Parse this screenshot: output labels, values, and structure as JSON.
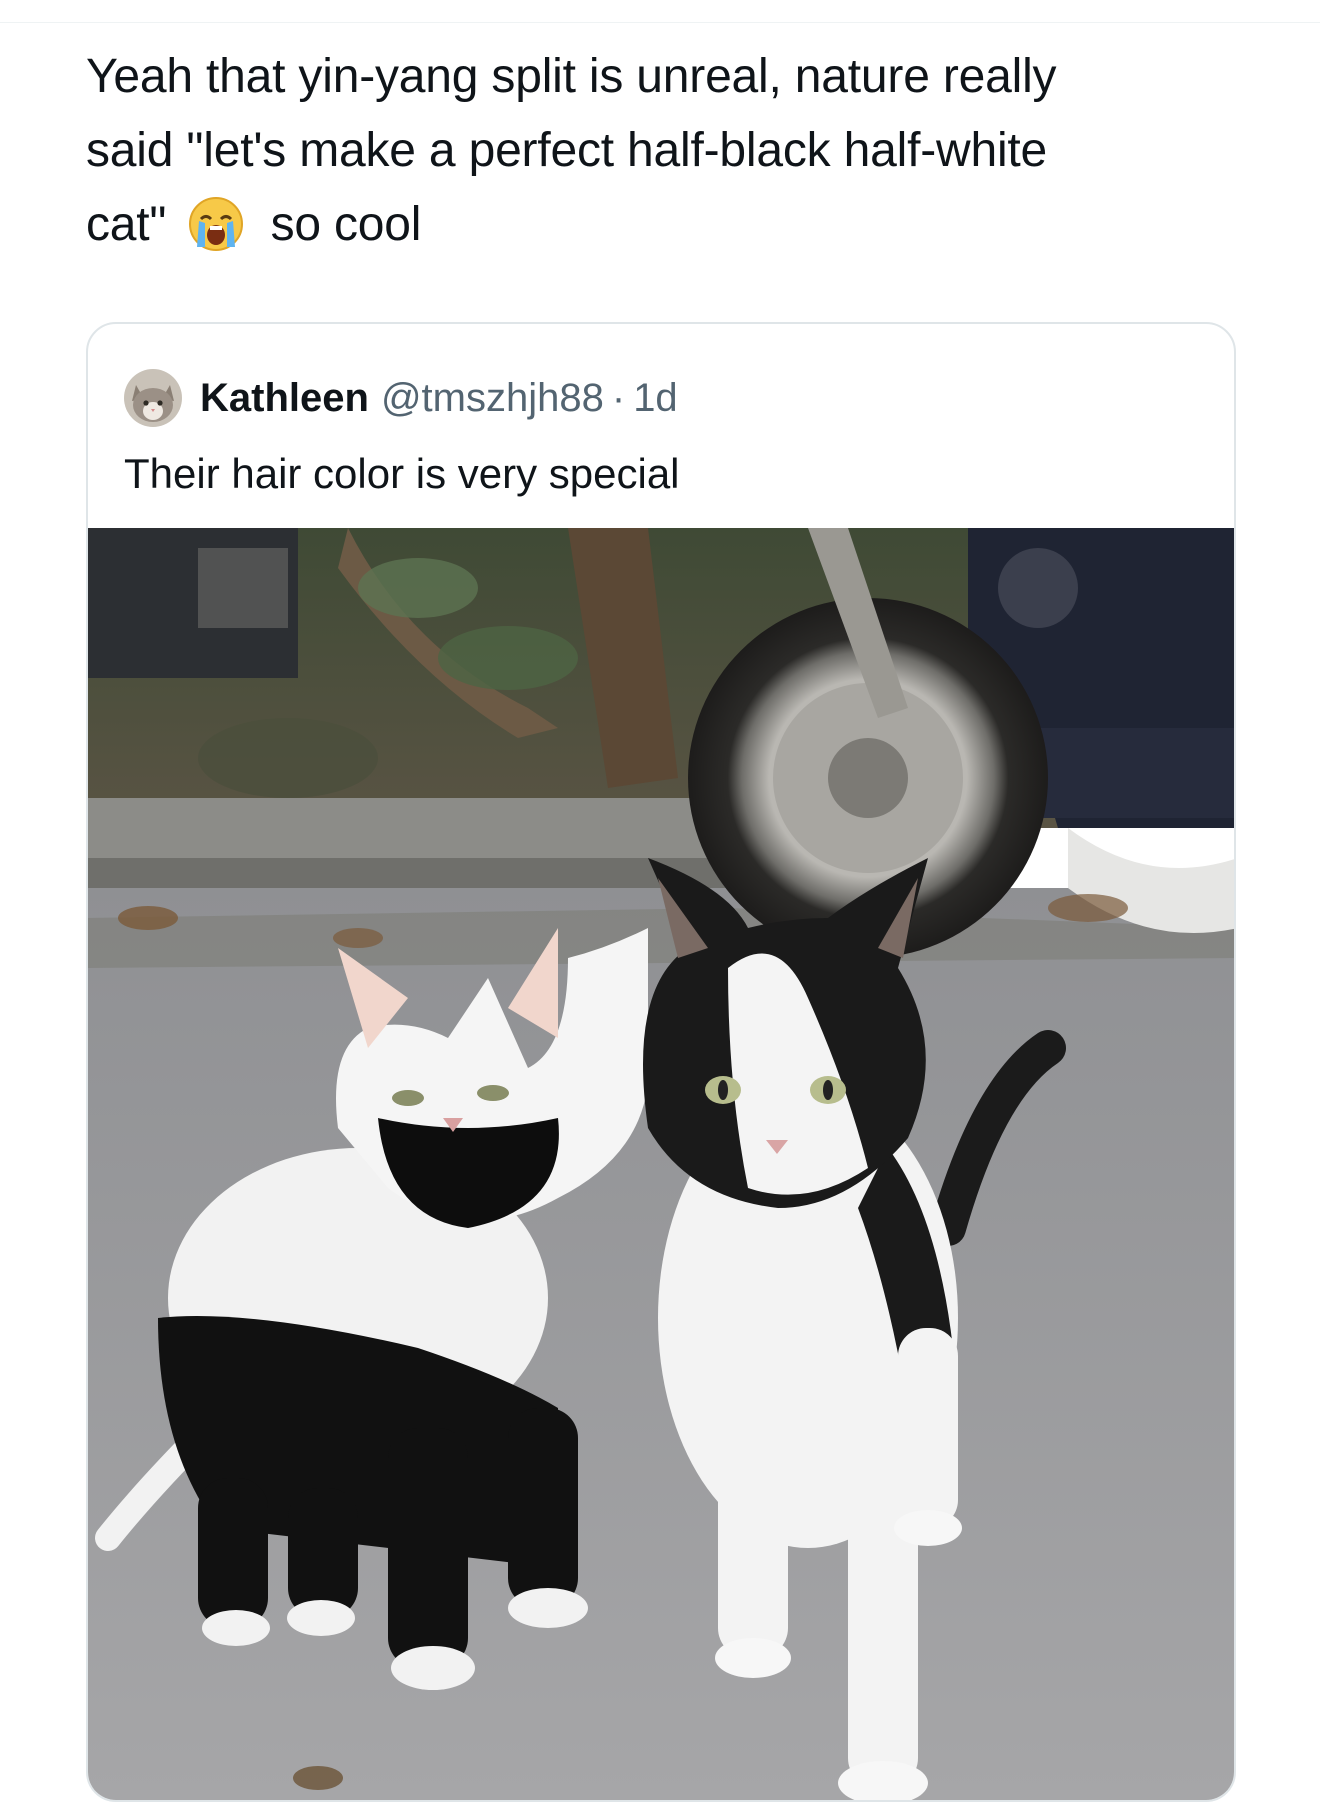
{
  "post": {
    "text_line1": "Yeah that yin-yang split is unreal, nature really",
    "text_line2": "said \"let's make a perfect half-black half-white",
    "text_line3_start": "cat\"",
    "text_line3_end": "so cool",
    "emoji": "loudly-crying-face-icon"
  },
  "quote": {
    "display_name": "Kathleen",
    "handle": "@tmszhjh88",
    "separator": "·",
    "time": "1d",
    "text": "Their hair color is very special",
    "avatar": "cat-avatar-icon",
    "image_description_icon": "two-kittens-photo"
  },
  "colors": {
    "text": "#0f1419",
    "muted": "#536471",
    "border": "#dfe5e8"
  }
}
